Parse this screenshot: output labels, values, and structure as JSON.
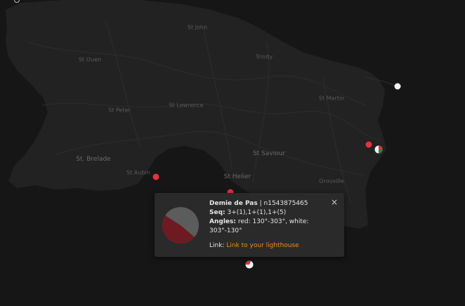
{
  "map": {
    "places": [
      {
        "name": "St John",
        "big": false
      },
      {
        "name": "St Ouen",
        "big": false
      },
      {
        "name": "Trinity",
        "big": false
      },
      {
        "name": "St Martin",
        "big": false
      },
      {
        "name": "St Peter",
        "big": false
      },
      {
        "name": "St Lawrence",
        "big": false
      },
      {
        "name": "St. Brelade",
        "big": true
      },
      {
        "name": "St Saviour",
        "big": true
      },
      {
        "name": "St Helier",
        "big": true
      },
      {
        "name": "St Aubin",
        "big": false
      },
      {
        "name": "Grouville",
        "big": false
      }
    ],
    "colors": {
      "land": "#222222",
      "water": "#161616",
      "road": "#2d2d2d",
      "label": "#5a5a5a"
    }
  },
  "markers": [
    {
      "type": "ring",
      "color": "#bbbbbb",
      "icon": "lighthouse-marker-icon"
    },
    {
      "type": "white",
      "color": "#f2f2f2",
      "icon": "lighthouse-marker-icon"
    },
    {
      "type": "red",
      "color": "#e8303f",
      "icon": "lighthouse-marker-icon"
    },
    {
      "type": "red",
      "color": "#e8303f",
      "icon": "lighthouse-marker-icon"
    },
    {
      "type": "red",
      "color": "#e8303f",
      "icon": "lighthouse-marker-icon"
    },
    {
      "type": "pie",
      "colors": [
        "#e8303f",
        "#f2f2f2",
        "#3a7a3a"
      ],
      "icon": "lighthouse-sector-icon"
    },
    {
      "type": "pie",
      "colors": [
        "#e8303f",
        "#f2f2f2"
      ],
      "icon": "lighthouse-sector-icon"
    }
  ],
  "popup": {
    "name": "Demie de Pas",
    "separator": " | ",
    "id": "n1543875465",
    "seq_label": "Seq:",
    "seq_value": " 3+(1),1+(1),1+(5)",
    "angles_label": "Angles:",
    "angles_value": " red: 130°-303°, white: 303°-130°",
    "link_label": "Link:",
    "link_text": "Link to your lighthouse",
    "close_glyph": "×",
    "sectors": [
      {
        "color": "red",
        "from": 130,
        "to": 303,
        "hex": "#6e1a22"
      },
      {
        "color": "white",
        "from": 303,
        "to": 130,
        "hex": "#5c5c5c"
      }
    ],
    "link_color": "#f08c1e"
  }
}
